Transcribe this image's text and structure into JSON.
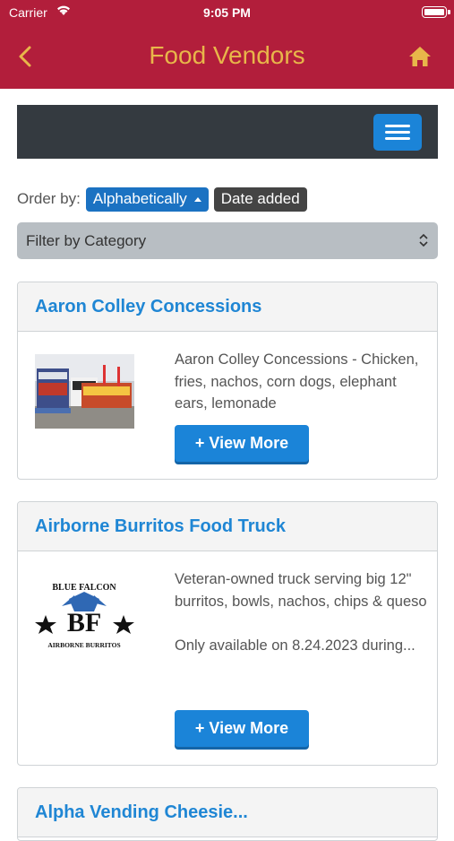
{
  "status": {
    "carrier": "Carrier",
    "time": "9:05 PM"
  },
  "nav": {
    "title": "Food Vendors"
  },
  "order": {
    "label": "Order by:",
    "options": [
      {
        "label": "Alphabetically",
        "active": true
      },
      {
        "label": "Date added",
        "active": false
      }
    ]
  },
  "filter": {
    "label": "Filter by Category"
  },
  "vendors": [
    {
      "name": "Aaron Colley Concessions",
      "description": [
        "Aaron Colley Concessions - Chicken, fries, nachos, corn dogs, elephant ears, lemonade"
      ],
      "button": "+ View More"
    },
    {
      "name": "Airborne Burritos Food Truck",
      "description": [
        "Veteran-owned truck serving big 12\" burritos, bowls, nachos, chips & queso",
        "Only available on 8.24.2023 during..."
      ],
      "button": "+ View More"
    },
    {
      "name": "Alpha Vending Cheesie..."
    }
  ],
  "colors": {
    "brand": "#b21e3b",
    "title_gold": "#e8b64a",
    "accent_blue": "#1b84d8"
  },
  "logo_text": {
    "top": "BLUE FALCON",
    "center": "BF",
    "bottom": "AIRBORNE BURRITOS"
  }
}
